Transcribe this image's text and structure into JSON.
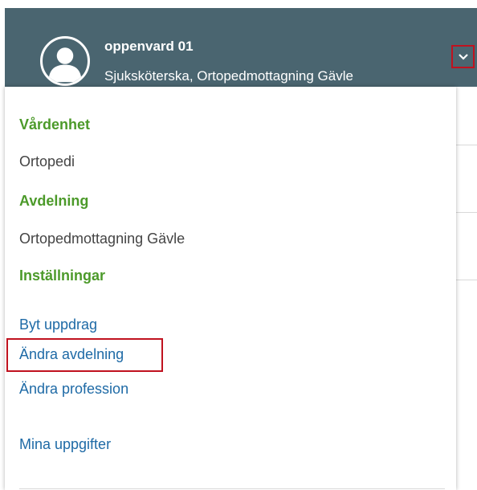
{
  "header": {
    "user_name": "oppenvard 01",
    "user_role": "Sjuksköterska, Ortopedmottagning Gävle",
    "avatar_icon": "user-avatar-icon",
    "dropdown_icon": "chevron-down-icon"
  },
  "dropdown": {
    "vardenhet_heading": "Vårdenhet",
    "vardenhet_value": "Ortopedi",
    "avdelning_heading": "Avdelning",
    "avdelning_value": "Ortopedmottagning Gävle",
    "installningar_heading": "Inställningar",
    "links": {
      "byt_uppdrag": "Byt uppdrag",
      "andra_avdelning": "Ändra avdelning",
      "andra_profession": "Ändra profession",
      "mina_uppgifter": "Mina uppgifter"
    }
  },
  "colors": {
    "header_bg": "#4a6570",
    "heading_green": "#4c9a2a",
    "link_blue": "#1e6aa6",
    "highlight_red": "#c0121f"
  }
}
